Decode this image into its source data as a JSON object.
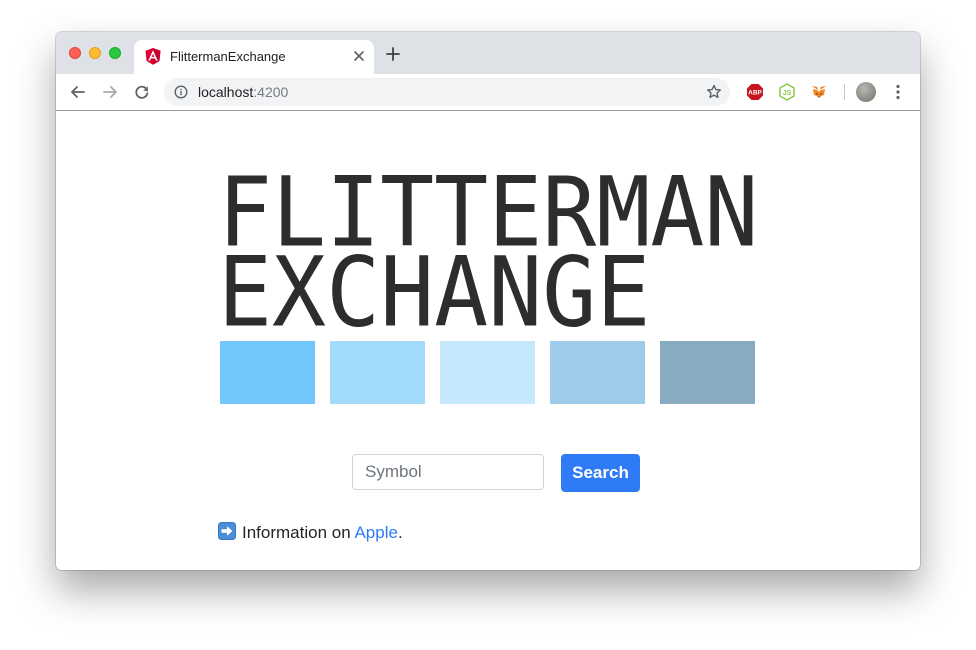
{
  "browser": {
    "tab": {
      "title": "FlittermanExchange",
      "favicon": "angular-icon"
    },
    "new_tab_label": "+",
    "address": {
      "host": "localhost",
      "port": ":4200"
    },
    "extensions": [
      "adblock-icon",
      "nodejs-icon",
      "metamask-icon"
    ],
    "colors": {
      "accent": "#2f7bf6",
      "tabstrip": "#dee1e6"
    }
  },
  "page": {
    "logo": {
      "line1": "FLITTERMAN",
      "line2": "EXCHANGE"
    },
    "swatches": [
      "#74c7fd",
      "#a3dbfb",
      "#c6e8fd",
      "#9dcbe9",
      "#88abc2"
    ],
    "search": {
      "placeholder": "Symbol",
      "value": "",
      "button_label": "Search"
    },
    "info": {
      "arrow_icon": "arrow-right-emoji",
      "prefix": "Information on ",
      "link_text": "Apple",
      "suffix": "."
    }
  }
}
